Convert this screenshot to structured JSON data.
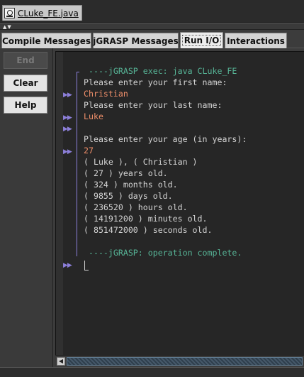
{
  "file_tab": {
    "name": "CLuke_FE.java"
  },
  "tabs": [
    {
      "label": "Compile Messages"
    },
    {
      "label": "jGRASP Messages"
    },
    {
      "label": "Run I/O"
    },
    {
      "label": "Interactions"
    }
  ],
  "active_tab": "Run I/O",
  "buttons": {
    "end": "End",
    "clear": "Clear",
    "help": "Help"
  },
  "console": {
    "lines": [
      {
        "text": " ----jGRASP exec: java CLuke_FE",
        "kind": "exec"
      },
      {
        "text": "Please enter your first name:",
        "kind": "output"
      },
      {
        "text": "Christian",
        "kind": "input"
      },
      {
        "text": "Please enter your last name:",
        "kind": "output"
      },
      {
        "text": "Luke",
        "kind": "input"
      },
      {
        "text": "",
        "kind": "output"
      },
      {
        "text": "Please enter your age (in years):",
        "kind": "output"
      },
      {
        "text": "27",
        "kind": "input"
      },
      {
        "text": "( Luke ), ( Christian )",
        "kind": "output"
      },
      {
        "text": "( 27 ) years old.",
        "kind": "output"
      },
      {
        "text": "( 324 ) months old.",
        "kind": "output"
      },
      {
        "text": "( 9855 ) days old.",
        "kind": "output"
      },
      {
        "text": "( 236520 ) hours old.",
        "kind": "output"
      },
      {
        "text": "( 14191200 ) minutes old.",
        "kind": "output"
      },
      {
        "text": "( 851472000 ) seconds old.",
        "kind": "output"
      },
      {
        "text": "",
        "kind": "output"
      },
      {
        "text": " ----jGRASP: operation complete.",
        "kind": "exec"
      }
    ],
    "input_arrow": "▶▶"
  },
  "colors": {
    "exec_text": "#57b597",
    "output_text": "#d4d4d4",
    "input_text": "#ef8f6a",
    "arrow": "#8c7fd9",
    "background": "#262626"
  }
}
